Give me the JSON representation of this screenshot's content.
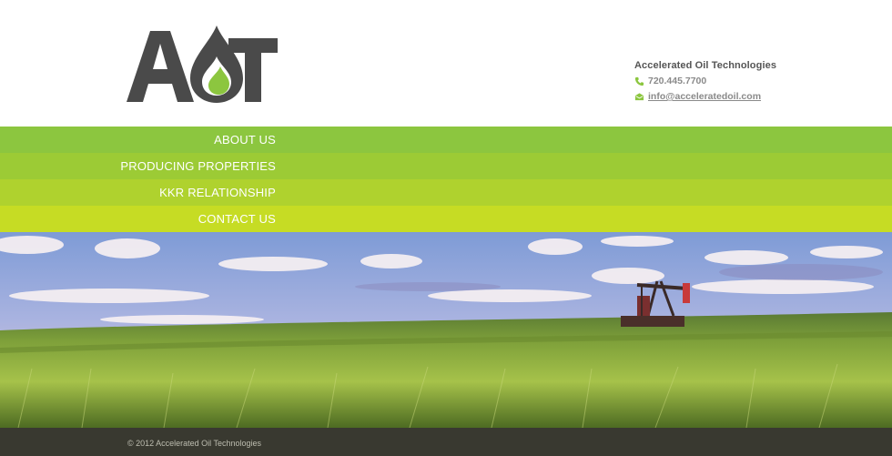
{
  "brand": {
    "logo_text": "AOT",
    "colors": {
      "dark": "#4a4a4a",
      "green": "#8cc63f",
      "lime": "#c6dc24"
    }
  },
  "contact": {
    "company": "Accelerated Oil Technologies",
    "phone": "720.445.7700",
    "phone_icon": "phone-icon",
    "email": "info@acceleratedoil.com",
    "email_icon": "envelope-icon"
  },
  "nav": {
    "items": [
      {
        "label": "ABOUT US",
        "color": "#8cc63f"
      },
      {
        "label": "PRODUCING PROPERTIES",
        "color": "#9ccb35"
      },
      {
        "label": "KKR RELATIONSHIP",
        "color": "#afd22e"
      },
      {
        "label": "CONTACT US",
        "color": "#c6dc24"
      }
    ]
  },
  "hero": {
    "description_icon": "pumpjack-field-image"
  },
  "footer": {
    "copyright": "© 2012 Accelerated Oil Technologies"
  }
}
